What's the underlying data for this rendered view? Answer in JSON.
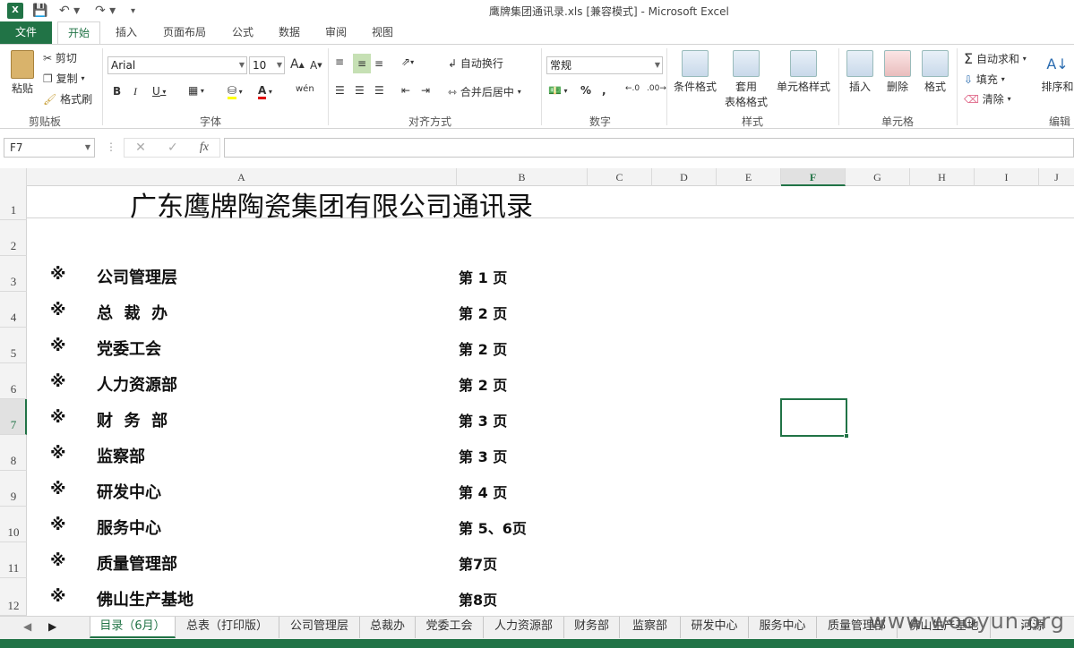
{
  "window": {
    "title": "鹰牌集团通讯录.xls  [兼容模式] - Microsoft Excel",
    "app_icon": "X"
  },
  "ribbon_tabs": [
    "文件",
    "开始",
    "插入",
    "页面布局",
    "公式",
    "数据",
    "审阅",
    "视图"
  ],
  "active_tab": "开始",
  "clipboard": {
    "paste": "粘贴",
    "cut": "剪切",
    "copy": "复制",
    "format_painter": "格式刷",
    "label": "剪贴板"
  },
  "font": {
    "name": "Arial",
    "size": "10",
    "label": "字体",
    "wen": "wén"
  },
  "alignment": {
    "wrap": "自动换行",
    "merge": "合并后居中",
    "label": "对齐方式"
  },
  "number": {
    "format": "常规",
    "label": "数字"
  },
  "styles": {
    "conditional": "条件格式",
    "table1": "套用",
    "table2": "表格格式",
    "cell_styles": "单元格样式",
    "label": "样式"
  },
  "cells": {
    "insert": "插入",
    "delete": "删除",
    "format": "格式",
    "label": "单元格"
  },
  "editing": {
    "autosum": "自动求和",
    "fill": "填充",
    "clear": "清除",
    "sort": "排序和",
    "label": "编辑"
  },
  "formula_bar": {
    "name_box": "F7",
    "fx": "fx",
    "value": ""
  },
  "columns": [
    "A",
    "B",
    "C",
    "D",
    "E",
    "F",
    "G",
    "H",
    "I",
    "J"
  ],
  "selected_column": "F",
  "rows": [
    "1",
    "2",
    "3",
    "4",
    "5",
    "6",
    "7",
    "8",
    "9",
    "10",
    "11",
    "12"
  ],
  "selected_row": "7",
  "sheet_title": "广东鹰牌陶瓷集团有限公司通讯录",
  "entries": [
    {
      "mark": "※",
      "name": "公司管理层",
      "page": "第 1 页"
    },
    {
      "mark": "※",
      "name": "总  裁  办",
      "page": "第 2 页"
    },
    {
      "mark": "※",
      "name": "党委工会",
      "page": "第 2 页"
    },
    {
      "mark": "※",
      "name": "人力资源部",
      "page": "第 2 页"
    },
    {
      "mark": "※",
      "name": "财  务  部",
      "page": "第 3 页"
    },
    {
      "mark": "※",
      "name": "监察部",
      "page": "第 3 页"
    },
    {
      "mark": "※",
      "name": "研发中心",
      "page": "第 4 页"
    },
    {
      "mark": "※",
      "name": "服务中心",
      "page": "第 5、6页"
    },
    {
      "mark": "※",
      "name": "质量管理部",
      "page": "第7页"
    },
    {
      "mark": "※",
      "name": "佛山生产基地",
      "page": "第8页"
    }
  ],
  "sheet_tabs": [
    "目录（6月）",
    "总表（打印版）",
    "公司管理层",
    "总裁办",
    "党委工会",
    "人力资源部",
    "财务部",
    "监察部",
    "研发中心",
    "服务中心",
    "质量管理部",
    "佛山生产基地",
    "河源"
  ],
  "active_sheet": "目录（6月）",
  "watermark": "www.wooyun.org"
}
